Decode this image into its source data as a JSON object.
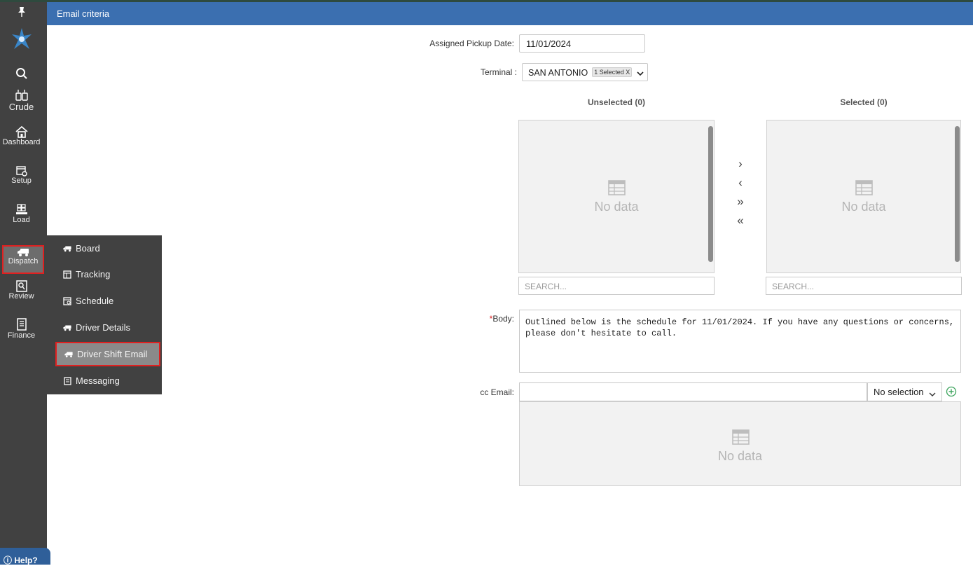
{
  "nav": {
    "items": [
      {
        "label": "",
        "icon": "pin-icon"
      },
      {
        "label": "",
        "icon": "app-logo-icon"
      },
      {
        "label": "",
        "icon": "search-icon"
      },
      {
        "label": "Crude",
        "icon": "crude-barrel-icon"
      },
      {
        "label": "Dashboard",
        "icon": "home-icon"
      },
      {
        "label": "Setup",
        "icon": "setup-gear-icon"
      },
      {
        "label": "Load",
        "icon": "load-pallet-icon"
      },
      {
        "label": "Dispatch",
        "icon": "truck-icon"
      },
      {
        "label": "Review",
        "icon": "review-icon"
      },
      {
        "label": "Finance",
        "icon": "finance-document-icon"
      }
    ],
    "help_label": "Help?"
  },
  "flyout": {
    "items": [
      {
        "label": "Board",
        "icon": "truck-icon"
      },
      {
        "label": "Tracking",
        "icon": "tracking-icon"
      },
      {
        "label": "Schedule",
        "icon": "schedule-icon"
      },
      {
        "label": "Driver Details",
        "icon": "truck-icon"
      },
      {
        "label": "Driver Shift Email",
        "icon": "truck-icon"
      },
      {
        "label": "Messaging",
        "icon": "messaging-icon"
      }
    ],
    "active": "Driver Shift Email"
  },
  "header": {
    "title": "Email criteria"
  },
  "form": {
    "pickup_date_label": "Assigned Pickup Date:",
    "pickup_date_value": "11/01/2024",
    "terminal_label": "Terminal :",
    "terminal_value": "SAN ANTONIO",
    "terminal_badge": "1 Selected",
    "terminal_badge_close": "X",
    "unselected_header": "Unselected (0)",
    "selected_header": "Selected (0)",
    "no_data": "No data",
    "search_placeholder": "SEARCH...",
    "move_right": "›",
    "move_left": "‹",
    "move_all_right": "»",
    "move_all_left": "«",
    "body_required_mark": "*",
    "body_label": "Body:",
    "body_value": "Outlined below is the schedule for 11/01/2024. If you have any questions or concerns, please don't hesitate to call.",
    "cc_label": "cc Email:",
    "cc_value": "",
    "cc_select": "No selection"
  },
  "colors": {
    "header_blue": "#3b6fb0",
    "nav_bg": "#414141",
    "highlight_red": "#e02020",
    "add_green": "#3aa35b"
  }
}
